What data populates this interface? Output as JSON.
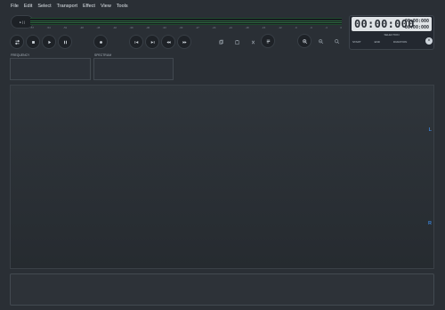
{
  "menu": {
    "file": "File",
    "edit": "Edit",
    "select": "Select",
    "transport": "Transport",
    "effect": "Effect",
    "view": "View",
    "tools": "Tools"
  },
  "meter": {
    "toggle_label": "▸ | |",
    "ticks": [
      "-57",
      "-54",
      "-51",
      "-48",
      "-45",
      "-42",
      "-39",
      "-36",
      "-33",
      "-30",
      "-27",
      "-24",
      "-21",
      "-18",
      "-15",
      "-12",
      "-9",
      "-6",
      "-3",
      "0"
    ]
  },
  "timer": {
    "main": "00:00:000",
    "top_right": "00:00:000",
    "bottom_right": "00:00:000",
    "selection_label": "SELECTION",
    "start_label": "START",
    "end_label": "END",
    "duration_label": "DURATION",
    "clear_symbol": "×"
  },
  "panels": {
    "frequency_label": "FREQUENCY",
    "spectrum_label": "SPECTRUM"
  },
  "channels": {
    "left": "L",
    "right": "R"
  },
  "icons": {
    "transport": [
      "loop-icon",
      "stop-icon",
      "play-icon",
      "pause-icon",
      "record-icon",
      "skip-back-icon",
      "skip-forward-icon",
      "rewind-icon",
      "fast-forward-icon"
    ],
    "tools": [
      "copy-icon",
      "paste-icon",
      "cut-icon",
      "undo-icon",
      "zoom-in-icon",
      "zoom-out-icon",
      "zoom-fit-icon"
    ]
  },
  "colors": {
    "background": "#2a2f35",
    "meter_green": "#2d6b40",
    "channel_blue": "#3b7fd0"
  }
}
